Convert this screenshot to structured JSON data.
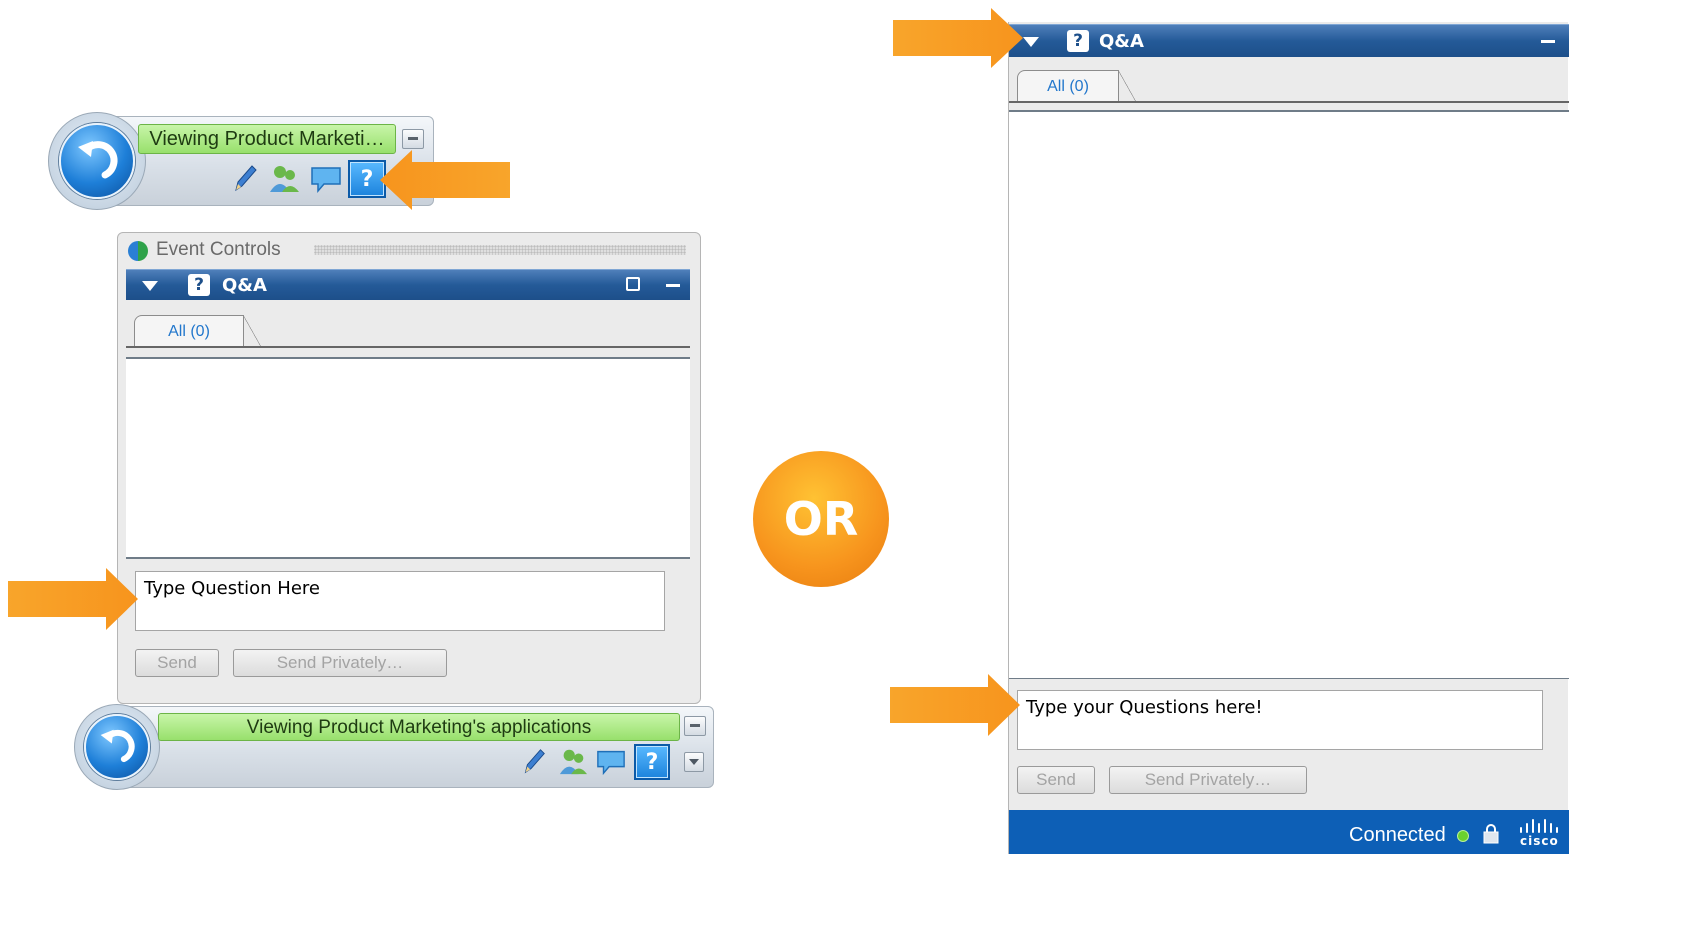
{
  "floating_toolbar": {
    "status": "Viewing Product Marketi…",
    "tools": [
      "pencil-icon",
      "participants-icon",
      "chat-icon",
      "qa-icon"
    ]
  },
  "event_controls": {
    "title": "Event Controls",
    "qa_header": "Q&A",
    "tab_all": "All (0)",
    "question_input": "Type Question Here",
    "send": "Send",
    "send_privately": "Send Privately…",
    "toolbar_status": "Viewing Product Marketing's applications"
  },
  "divider": {
    "text": "OR"
  },
  "docked_panel": {
    "qa_header": "Q&A",
    "tab_all": "All (0)",
    "question_input": "Type your Questions here!",
    "send": "Send",
    "send_privately": "Send Privately…",
    "status": "Connected",
    "brand": "cisco"
  },
  "colors": {
    "accent_blue": "#245a98",
    "status_green": "#98e06c",
    "arrow_orange": "#f7941d",
    "status_bar": "#0d5fb6"
  }
}
